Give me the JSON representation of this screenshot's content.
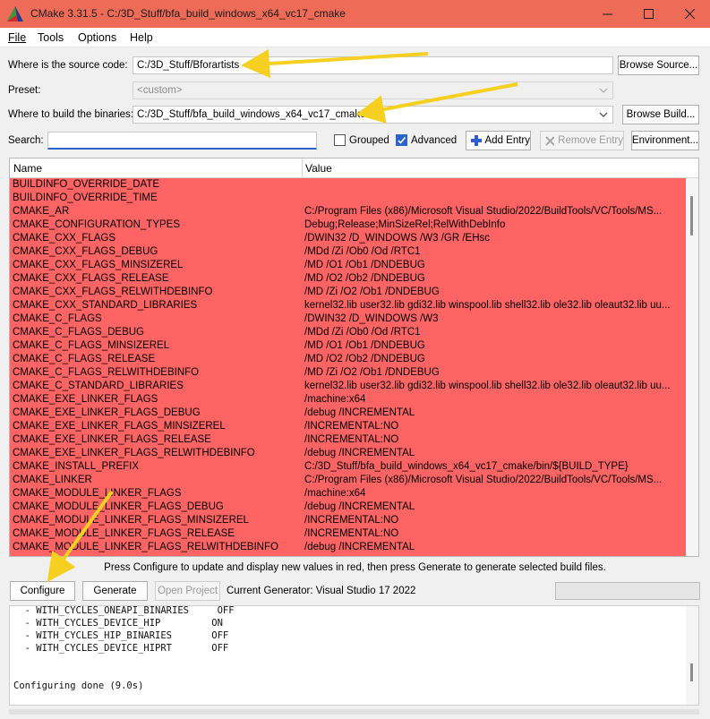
{
  "window": {
    "title": "CMake 3.31.5 - C:/3D_Stuff/bfa_build_windows_x64_vc17_cmake",
    "titlebar_color": "#ee6b57"
  },
  "menu": [
    "File",
    "Tools",
    "Options",
    "Help"
  ],
  "source": {
    "label": "Where is the source code:",
    "value": "C:/3D_Stuff/Bforartists",
    "button": "Browse Source..."
  },
  "preset": {
    "label": "Preset:",
    "value": "<custom>"
  },
  "binaries": {
    "label": "Where to build the binaries:",
    "value": "C:/3D_Stuff/bfa_build_windows_x64_vc17_cmake",
    "button": "Browse Build..."
  },
  "search": {
    "label": "Search:",
    "value": "",
    "grouped_label": "Grouped",
    "grouped_checked": false,
    "advanced_label": "Advanced",
    "advanced_checked": true,
    "add_entry": "Add Entry",
    "remove_entry": "Remove Entry",
    "environment": "Environment..."
  },
  "table": {
    "headers": [
      "Name",
      "Value"
    ],
    "row_color": "#ff6464",
    "rows": [
      [
        "BUILDINFO_OVERRIDE_DATE",
        ""
      ],
      [
        "BUILDINFO_OVERRIDE_TIME",
        ""
      ],
      [
        "CMAKE_AR",
        "C:/Program Files (x86)/Microsoft Visual Studio/2022/BuildTools/VC/Tools/MS..."
      ],
      [
        "CMAKE_CONFIGURATION_TYPES",
        "Debug;Release;MinSizeRel;RelWithDebInfo"
      ],
      [
        "CMAKE_CXX_FLAGS",
        "/DWIN32 /D_WINDOWS /W3 /GR /EHsc"
      ],
      [
        "CMAKE_CXX_FLAGS_DEBUG",
        "/MDd /Zi /Ob0 /Od /RTC1"
      ],
      [
        "CMAKE_CXX_FLAGS_MINSIZEREL",
        "/MD /O1 /Ob1 /DNDEBUG"
      ],
      [
        "CMAKE_CXX_FLAGS_RELEASE",
        "/MD /O2 /Ob2 /DNDEBUG"
      ],
      [
        "CMAKE_CXX_FLAGS_RELWITHDEBINFO",
        "/MD /Zi /O2 /Ob1 /DNDEBUG"
      ],
      [
        "CMAKE_CXX_STANDARD_LIBRARIES",
        "kernel32.lib user32.lib gdi32.lib winspool.lib shell32.lib ole32.lib oleaut32.lib uu..."
      ],
      [
        "CMAKE_C_FLAGS",
        "/DWIN32 /D_WINDOWS /W3"
      ],
      [
        "CMAKE_C_FLAGS_DEBUG",
        "/MDd /Zi /Ob0 /Od /RTC1"
      ],
      [
        "CMAKE_C_FLAGS_MINSIZEREL",
        "/MD /O1 /Ob1 /DNDEBUG"
      ],
      [
        "CMAKE_C_FLAGS_RELEASE",
        "/MD /O2 /Ob2 /DNDEBUG"
      ],
      [
        "CMAKE_C_FLAGS_RELWITHDEBINFO",
        "/MD /Zi /O2 /Ob1 /DNDEBUG"
      ],
      [
        "CMAKE_C_STANDARD_LIBRARIES",
        "kernel32.lib user32.lib gdi32.lib winspool.lib shell32.lib ole32.lib oleaut32.lib uu..."
      ],
      [
        "CMAKE_EXE_LINKER_FLAGS",
        "/machine:x64"
      ],
      [
        "CMAKE_EXE_LINKER_FLAGS_DEBUG",
        "/debug /INCREMENTAL"
      ],
      [
        "CMAKE_EXE_LINKER_FLAGS_MINSIZEREL",
        "/INCREMENTAL:NO"
      ],
      [
        "CMAKE_EXE_LINKER_FLAGS_RELEASE",
        "/INCREMENTAL:NO"
      ],
      [
        "CMAKE_EXE_LINKER_FLAGS_RELWITHDEBINFO",
        "/debug /INCREMENTAL"
      ],
      [
        "CMAKE_INSTALL_PREFIX",
        "C:/3D_Stuff/bfa_build_windows_x64_vc17_cmake/bin/${BUILD_TYPE}"
      ],
      [
        "CMAKE_LINKER",
        "C:/Program Files (x86)/Microsoft Visual Studio/2022/BuildTools/VC/Tools/MS..."
      ],
      [
        "CMAKE_MODULE_LINKER_FLAGS",
        "/machine:x64"
      ],
      [
        "CMAKE_MODULE_LINKER_FLAGS_DEBUG",
        "/debug /INCREMENTAL"
      ],
      [
        "CMAKE_MODULE_LINKER_FLAGS_MINSIZEREL",
        "/INCREMENTAL:NO"
      ],
      [
        "CMAKE_MODULE_LINKER_FLAGS_RELEASE",
        "/INCREMENTAL:NO"
      ],
      [
        "CMAKE_MODULE_LINKER_FLAGS_RELWITHDEBINFO",
        "/debug /INCREMENTAL"
      ]
    ]
  },
  "hint": "Press Configure to update and display new values in red, then press Generate to generate selected build files.",
  "actions": {
    "configure": "Configure",
    "generate": "Generate",
    "open_project": "Open Project",
    "current_generator": "Current Generator: Visual Studio 17 2022"
  },
  "output": {
    "lines": [
      "  - WITH_CYCLES_ONEAPI_BINARIES     OFF",
      "  - WITH_CYCLES_DEVICE_HIP         ON",
      "  - WITH_CYCLES_HIP_BINARIES       OFF",
      "  - WITH_CYCLES_DEVICE_HIPRT       OFF",
      "",
      "",
      "Configuring done (9.0s)"
    ]
  },
  "annotation_color": "#f5d020"
}
